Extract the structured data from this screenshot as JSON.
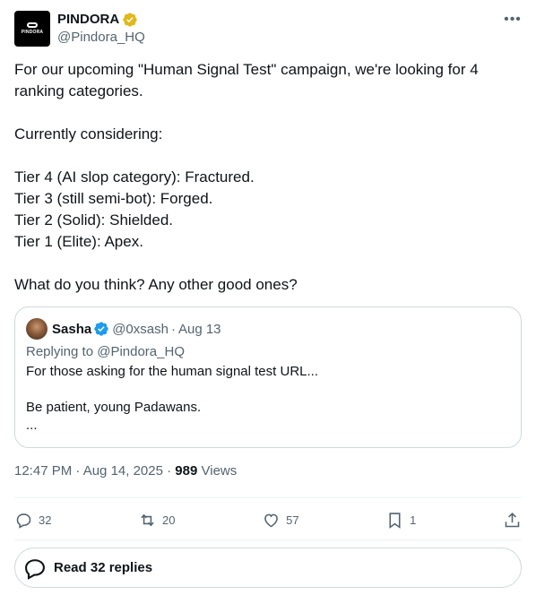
{
  "author": {
    "logo_text": "PINDORA",
    "display_name": "PINDORA",
    "handle": "@Pindora_HQ",
    "verified_color": "#e2b719"
  },
  "tweet": {
    "text": "For our upcoming \"Human Signal Test\" campaign, we're looking for 4 ranking categories.\n\nCurrently considering:\n\nTier 4 (AI slop category): Fractured.\nTier 3 (still semi-bot): Forged.\nTier 2 (Solid): Shielded.\nTier 1 (Elite): Apex.\n\nWhat do you think? Any other good ones?"
  },
  "quote": {
    "name": "Sasha",
    "handle": "@0xsash",
    "separator": "·",
    "date": "Aug 13",
    "verified_color": "#1d9bf0",
    "replying_prefix": "Replying to",
    "replying_to": "@Pindora_HQ",
    "text": "For those asking for the human signal test URL...\n\nBe patient, young Padawans.\n..."
  },
  "meta": {
    "time": "12:47 PM · Aug 14, 2025 · ",
    "views_count": "989",
    "views_label": "Views"
  },
  "actions": {
    "replies": "32",
    "reposts": "20",
    "likes": "57",
    "bookmarks": "1"
  },
  "read_replies": {
    "label": "Read 32 replies"
  }
}
